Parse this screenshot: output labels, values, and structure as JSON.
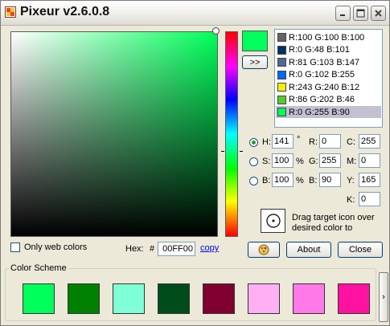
{
  "window": {
    "title": "Pixeur v2.6.0.8",
    "controls": [
      "minimize",
      "maximize",
      "close"
    ]
  },
  "picker": {
    "current_color": "#00ff5a",
    "transfer_button": ">>"
  },
  "history": [
    {
      "label": "R:100 G:100 B:100",
      "color": "#646464"
    },
    {
      "label": "R:0 G:48 B:101",
      "color": "#003065"
    },
    {
      "label": "R:81 G:103 B:147",
      "color": "#516793"
    },
    {
      "label": "R:0 G:102 B:255",
      "color": "#0066ff"
    },
    {
      "label": "R:243 G:240 B:12",
      "color": "#f3f00c"
    },
    {
      "label": "R:86 G:202 B:46",
      "color": "#56ca2e"
    },
    {
      "label": "R:0 G:255 B:90",
      "color": "#00ff5a",
      "selected": true
    }
  ],
  "hsb": {
    "h_label": "H:",
    "h_value": "141",
    "h_unit": "°",
    "s_label": "S:",
    "s_value": "100",
    "s_unit": "%",
    "b_label": "B:",
    "b_value": "100",
    "b_unit": "%",
    "selected": "H"
  },
  "rgb": {
    "r_label": "R:",
    "r_value": "0",
    "g_label": "G:",
    "g_value": "255",
    "b_label": "B:",
    "b_value": "90"
  },
  "cmyk": {
    "c_label": "C:",
    "c_value": "255",
    "m_label": "M:",
    "m_value": "0",
    "y_label": "Y:",
    "y_value": "165",
    "k_label": "K:",
    "k_value": "0"
  },
  "web_colors": {
    "label": "Only web colors",
    "checked": false
  },
  "hex": {
    "label": "Hex:",
    "prefix": "#",
    "value": "00FF00",
    "copy": "copy"
  },
  "target": {
    "text": "Drag target icon over desired color to"
  },
  "buttons": {
    "about": "About",
    "close": "Close"
  },
  "color_scheme": {
    "title": "Color Scheme",
    "swatches": [
      "#00ff5a",
      "#008000",
      "#7fffd6",
      "#004d1b",
      "#800030",
      "#ffb0f5",
      "#ff7ae8",
      "#ff12a0"
    ],
    "next": "›"
  }
}
